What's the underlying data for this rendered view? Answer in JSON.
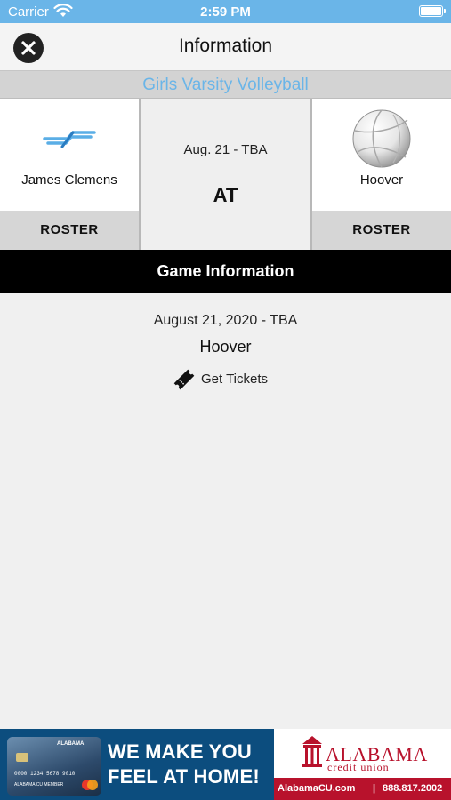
{
  "status_bar": {
    "carrier": "Carrier",
    "time": "2:59 PM"
  },
  "nav": {
    "title": "Information"
  },
  "sport": {
    "name": "Girls Varsity Volleyball"
  },
  "matchup": {
    "home_team": {
      "name": "James Clemens",
      "roster_label": "ROSTER",
      "logo": "james-clemens-logo"
    },
    "away_team": {
      "name": "Hoover",
      "roster_label": "ROSTER",
      "logo": "volleyball-icon"
    },
    "date": "Aug. 21 - TBA",
    "separator": "AT"
  },
  "game_info": {
    "header": "Game Information",
    "full_date": "August 21, 2020 - TBA",
    "location": "Hoover",
    "tickets_label": "Get Tickets"
  },
  "ad": {
    "headline_line1": "WE MAKE YOU",
    "headline_line2": "FEEL AT HOME!",
    "bank_name": "ALABAMA",
    "bank_sub": "credit union",
    "url": "AlabamaCU.com",
    "separator": "|",
    "phone": "888.817.2002",
    "card_brand": "ALABAMA",
    "card_number": "0000 1234 5678 9010",
    "card_name": "ALABAMA CU MEMBER",
    "colors": {
      "navy": "#0c4d7e",
      "red": "#b8122c"
    }
  },
  "colors": {
    "accent_blue": "#6ab5e8",
    "header_black": "#000000",
    "roster_gray": "#d6d6d6"
  }
}
